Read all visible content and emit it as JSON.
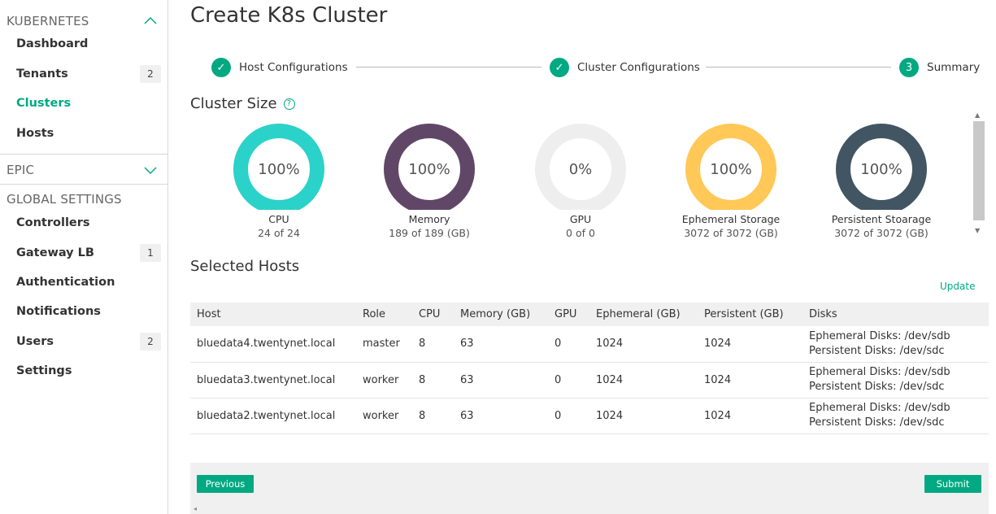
{
  "page": {
    "title": "Create K8s Cluster"
  },
  "sidebar": {
    "kubernetes_header": "KUBERNETES",
    "kubernetes_items": [
      {
        "label": "Dashboard",
        "badge": ""
      },
      {
        "label": "Tenants",
        "badge": "2"
      },
      {
        "label": "Clusters",
        "badge": ""
      },
      {
        "label": "Hosts",
        "badge": ""
      }
    ],
    "epic_header": "EPIC",
    "global_header": "GLOBAL SETTINGS",
    "global_items": [
      {
        "label": "Controllers",
        "badge": ""
      },
      {
        "label": "Gateway LB",
        "badge": "1"
      },
      {
        "label": "Authentication",
        "badge": ""
      },
      {
        "label": "Notifications",
        "badge": ""
      },
      {
        "label": "Users",
        "badge": "2"
      },
      {
        "label": "Settings",
        "badge": ""
      }
    ]
  },
  "stepper": {
    "steps": [
      {
        "label": "Host Configurations",
        "marker": "✓"
      },
      {
        "label": "Cluster Configurations",
        "marker": "✓"
      },
      {
        "label": "Summary",
        "marker": "3"
      }
    ]
  },
  "cluster_size": {
    "title": "Cluster Size",
    "help_icon": "?",
    "gauges": [
      {
        "name": "CPU",
        "value": "24 of 24",
        "percent_label": "100%",
        "fill": 1.0,
        "color": "#2ad2c9"
      },
      {
        "name": "Memory",
        "value": "189 of 189 (GB)",
        "percent_label": "100%",
        "fill": 1.0,
        "color": "#614767"
      },
      {
        "name": "GPU",
        "value": "0 of 0",
        "percent_label": "0%",
        "fill": 0.0,
        "color": "#eeeeee"
      },
      {
        "name": "Ephemeral Storage",
        "value": "3072 of 3072 (GB)",
        "percent_label": "100%",
        "fill": 1.0,
        "color": "#ffc857"
      },
      {
        "name": "Persistent Stoarage",
        "value": "3072 of 3072 (GB)",
        "percent_label": "100%",
        "fill": 1.0,
        "color": "#425563"
      }
    ]
  },
  "selected_hosts": {
    "title": "Selected Hosts",
    "update_label": "Update",
    "columns": [
      "Host",
      "Role",
      "CPU",
      "Memory (GB)",
      "GPU",
      "Ephemeral (GB)",
      "Persistent (GB)",
      "Disks"
    ],
    "rows": [
      {
        "host": "bluedata4.twentynet.local",
        "role": "master",
        "cpu": "8",
        "memory": "63",
        "gpu": "0",
        "ephemeral": "1024",
        "persistent": "1024",
        "disk1": "Ephemeral Disks: /dev/sdb",
        "disk2": "Persistent Disks: /dev/sdc"
      },
      {
        "host": "bluedata3.twentynet.local",
        "role": "worker",
        "cpu": "8",
        "memory": "63",
        "gpu": "0",
        "ephemeral": "1024",
        "persistent": "1024",
        "disk1": "Ephemeral Disks: /dev/sdb",
        "disk2": "Persistent Disks: /dev/sdc"
      },
      {
        "host": "bluedata2.twentynet.local",
        "role": "worker",
        "cpu": "8",
        "memory": "63",
        "gpu": "0",
        "ephemeral": "1024",
        "persistent": "1024",
        "disk1": "Ephemeral Disks: /dev/sdb",
        "disk2": "Persistent Disks: /dev/sdc"
      }
    ]
  },
  "footer": {
    "previous_label": "Previous",
    "submit_label": "Submit",
    "scroll_hint": "◂"
  },
  "colors": {
    "accent": "#01a982"
  }
}
